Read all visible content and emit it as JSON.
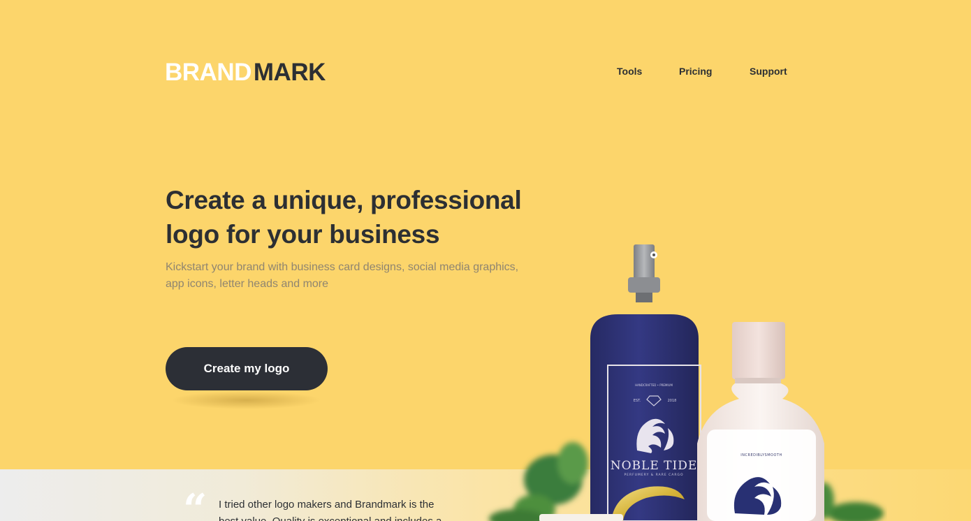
{
  "header": {
    "logo_brand": "BRAND",
    "logo_mark": "MARK",
    "nav": [
      {
        "label": "Tools"
      },
      {
        "label": "Pricing"
      },
      {
        "label": "Support"
      }
    ]
  },
  "hero": {
    "title_line1": "Create a unique, professional",
    "title_line2": "logo for your business",
    "subtitle_line1": "Kickstart your brand with business card designs, social media graphics,",
    "subtitle_line2": "app icons, letter heads and more",
    "cta_label": "Create my logo"
  },
  "product": {
    "blue_bottle_label": "NOBLE TIDE",
    "blue_bottle_sub": "PERFUMERY & RARE CARGO",
    "blue_bottle_est": "EST.",
    "blue_bottle_year": "2018",
    "white_bottle_label": "INCREDIBLYSMOOTH"
  },
  "testimonial": {
    "quote_mark": "“",
    "text": "I tried other logo makers and Brandmark is the best value. Quality is exceptional and includes a"
  },
  "colors": {
    "background": "#fcd56b",
    "dark": "#2c2f33",
    "bottle_blue": "#2e3170",
    "bottle_white": "#f5ede9"
  }
}
